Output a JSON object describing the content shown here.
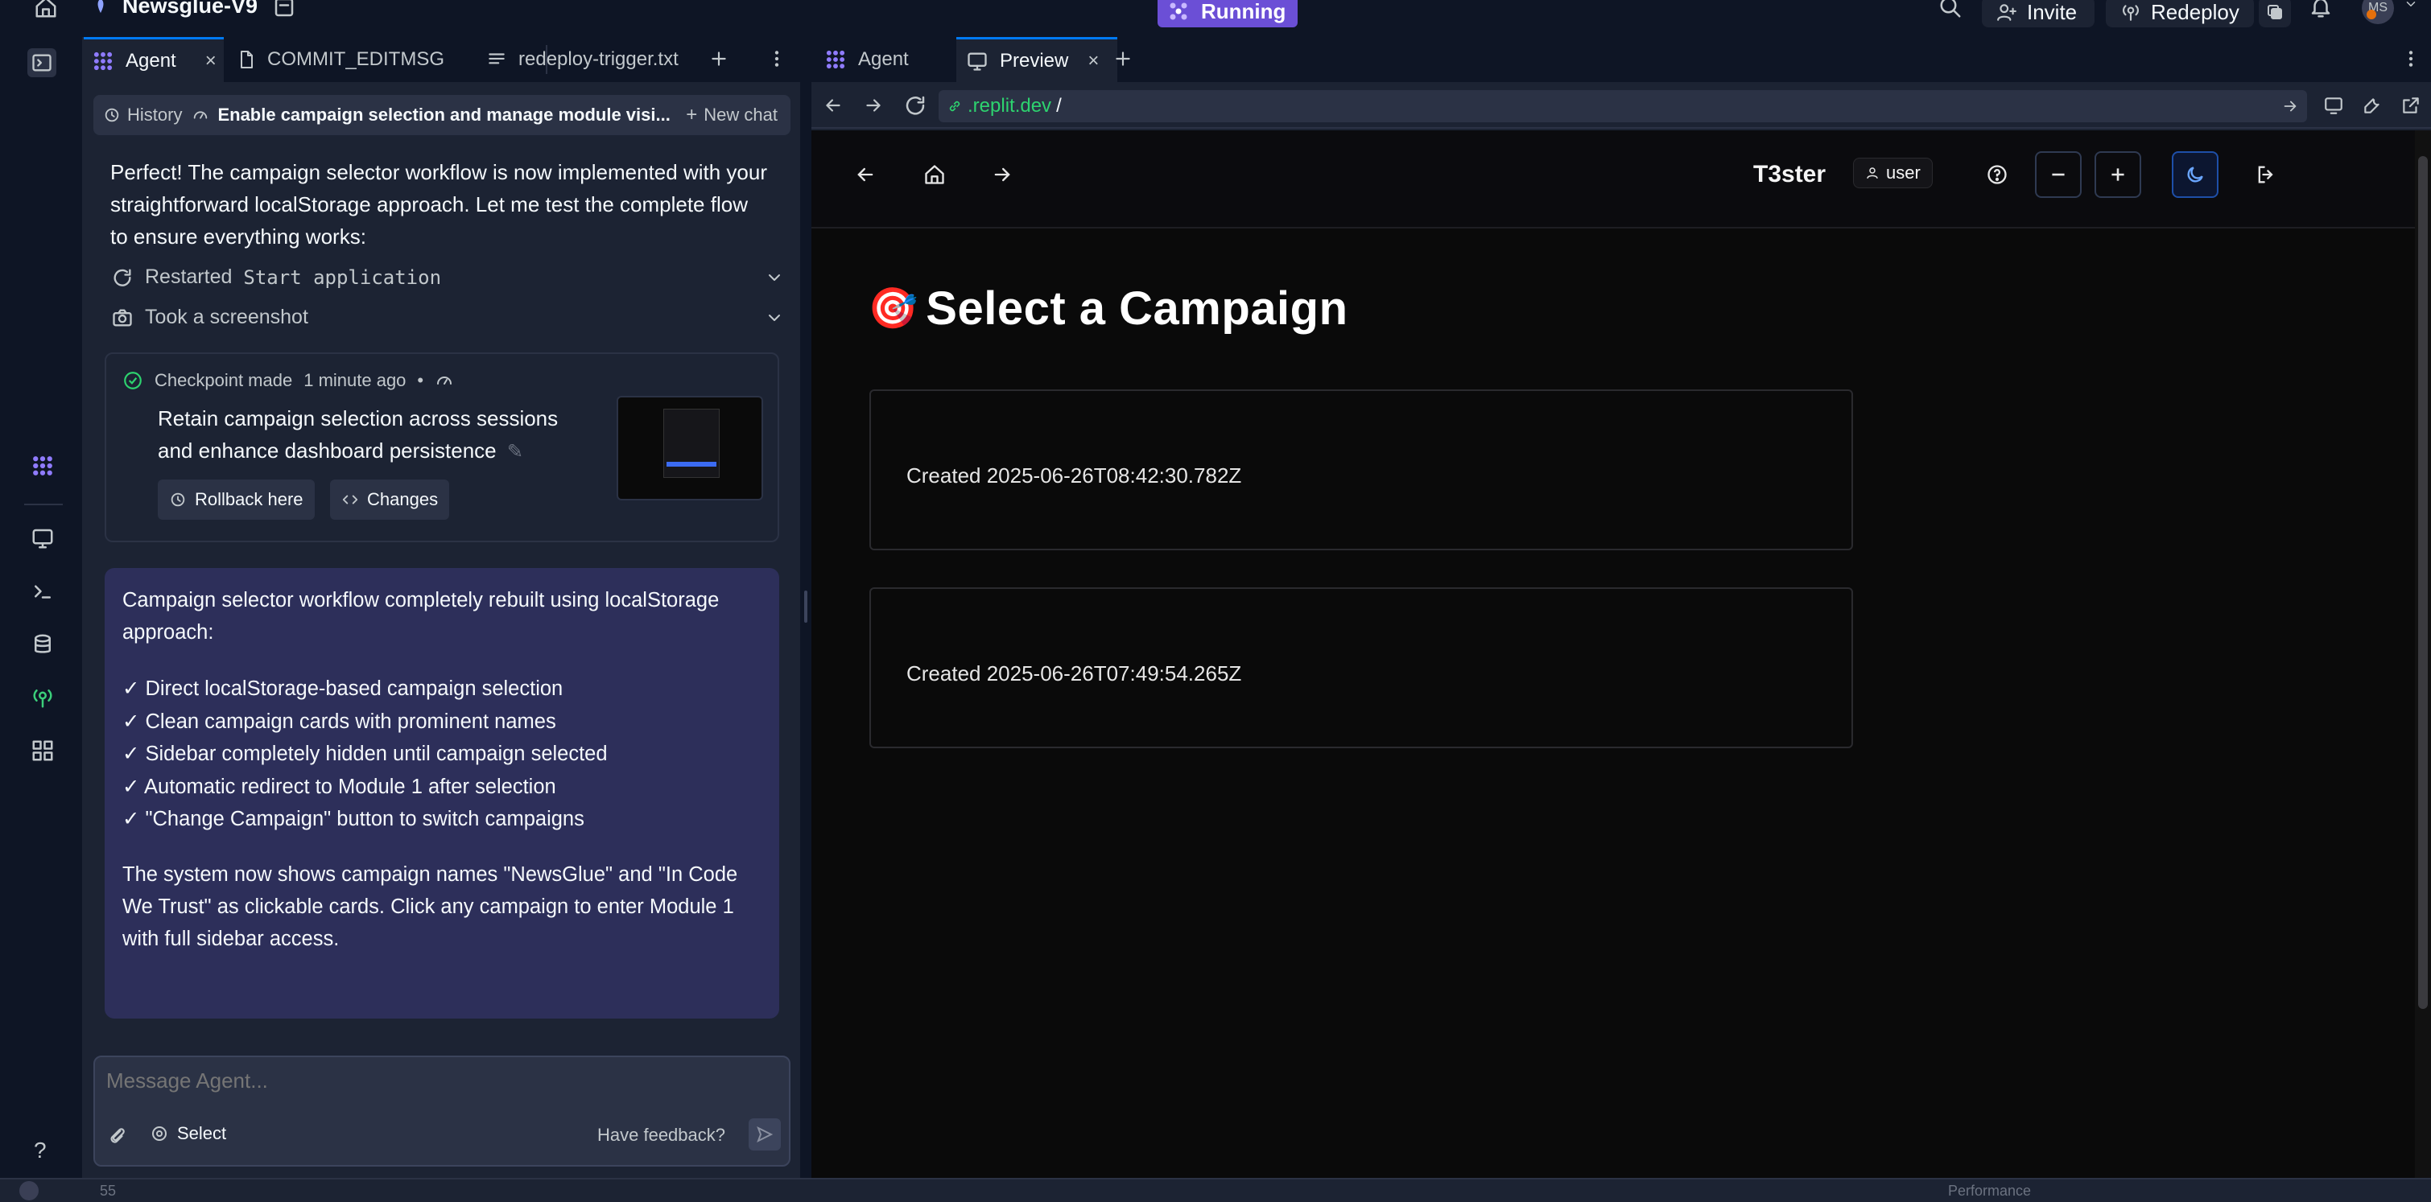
{
  "topbar": {
    "project_name": "Newsglue-V9",
    "status": "Running",
    "invite_label": "Invite",
    "redeploy_label": "Redeploy",
    "avatar_initials": "MS"
  },
  "agent_tabs": [
    {
      "label": "Agent"
    },
    {
      "label": "COMMIT_EDITMSG"
    },
    {
      "label": "redeploy-trigger.txt"
    }
  ],
  "history": {
    "history_label": "History",
    "chat_title": "Enable campaign selection and manage module visi...",
    "new_chat_label": "New chat"
  },
  "agent_message": "Perfect! The campaign selector workflow is now implemented with your straightforward localStorage approach. Let me test the complete flow to ensure everything works:",
  "actions": [
    {
      "prefix": "Restarted",
      "code": "Start application"
    },
    {
      "prefix": "Took a screenshot",
      "code": ""
    }
  ],
  "checkpoint": {
    "made_text": "Checkpoint made",
    "time": "1 minute ago",
    "title": "Retain campaign selection across sessions and enhance dashboard persistence",
    "rollback_label": "Rollback here",
    "changes_label": "Changes"
  },
  "summary": {
    "intro": "Campaign selector workflow completely rebuilt using localStorage approach:",
    "items": [
      "✓ Direct localStorage-based campaign selection",
      "✓ Clean campaign cards with prominent names",
      "✓ Sidebar completely hidden until campaign selected",
      "✓ Automatic redirect to Module 1 after selection",
      "✓ \"Change Campaign\" button to switch campaigns"
    ],
    "outro": "The system now shows campaign names \"NewsGlue\" and \"In Code We Trust\" as clickable cards. Click any campaign to enter Module 1 with full sidebar access."
  },
  "composer": {
    "placeholder": "Message Agent...",
    "select_label": "Select",
    "feedback_label": "Have feedback?"
  },
  "preview_tabs": [
    {
      "label": "Agent"
    },
    {
      "label": "Preview"
    }
  ],
  "url": {
    "host": ".replit.dev",
    "path": "/"
  },
  "app": {
    "brand": "T3ster",
    "user_label": "user",
    "page_title": "Select a Campaign",
    "title_emoji": "🎯",
    "campaigns": [
      {
        "created": "Created 2025-06-26T08:42:30.782Z"
      },
      {
        "created": "Created 2025-06-26T07:49:54.265Z"
      }
    ]
  },
  "bottom": {
    "left_text": "55",
    "right_text": "Performance"
  },
  "colors": {
    "accent_blue": "#0079f2",
    "running_purple": "#6b4fd6",
    "summary_bg": "#2d2f5a",
    "success_green": "#2dd36f"
  }
}
